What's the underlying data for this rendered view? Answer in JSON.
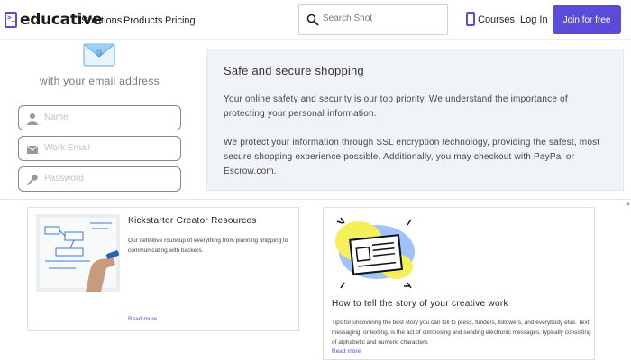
{
  "navbar": {
    "logo_text": "educative",
    "links": [
      "Solutions",
      "Products",
      "Pricing"
    ],
    "search_placeholder": "Search Shot",
    "courses_label": "Courses",
    "login_label": "Log In",
    "join_label": "Join for free"
  },
  "signup": {
    "caption": "with your email address",
    "fields": [
      {
        "placeholder": "Name",
        "icon": "user-icon"
      },
      {
        "placeholder": "Work Email",
        "icon": "envelope-icon"
      },
      {
        "placeholder": "Password",
        "icon": "key-icon"
      }
    ]
  },
  "info": {
    "title": "Safe and secure shopping",
    "paragraph1": "Your online safety and security is our top priority. We understand the importance of protecting your personal information.",
    "paragraph2": "We protect your information through SSL encryption technology, providing the safest, most secure shopping experience possible. Additionally, you may checkout with PayPal or Escrow.com."
  },
  "cards": [
    {
      "title": "Kickstarter Creator Resources",
      "description": "Our definitive roundup of everything from planning shipping to communicating with backers.",
      "read_more": "Read more"
    },
    {
      "title": "How to tell the story of your creative work",
      "description": "Tips for uncovering the best story you can tell to press, funders, followers, and everybody else. Text messaging, or texting, is the act of composing and sending electronic messages, typically consisting of alphabetic and numeric characters",
      "read_more": "Read more"
    }
  ],
  "colors": {
    "accent": "#5b4bdb",
    "info_bg": "#f1f4f7"
  }
}
